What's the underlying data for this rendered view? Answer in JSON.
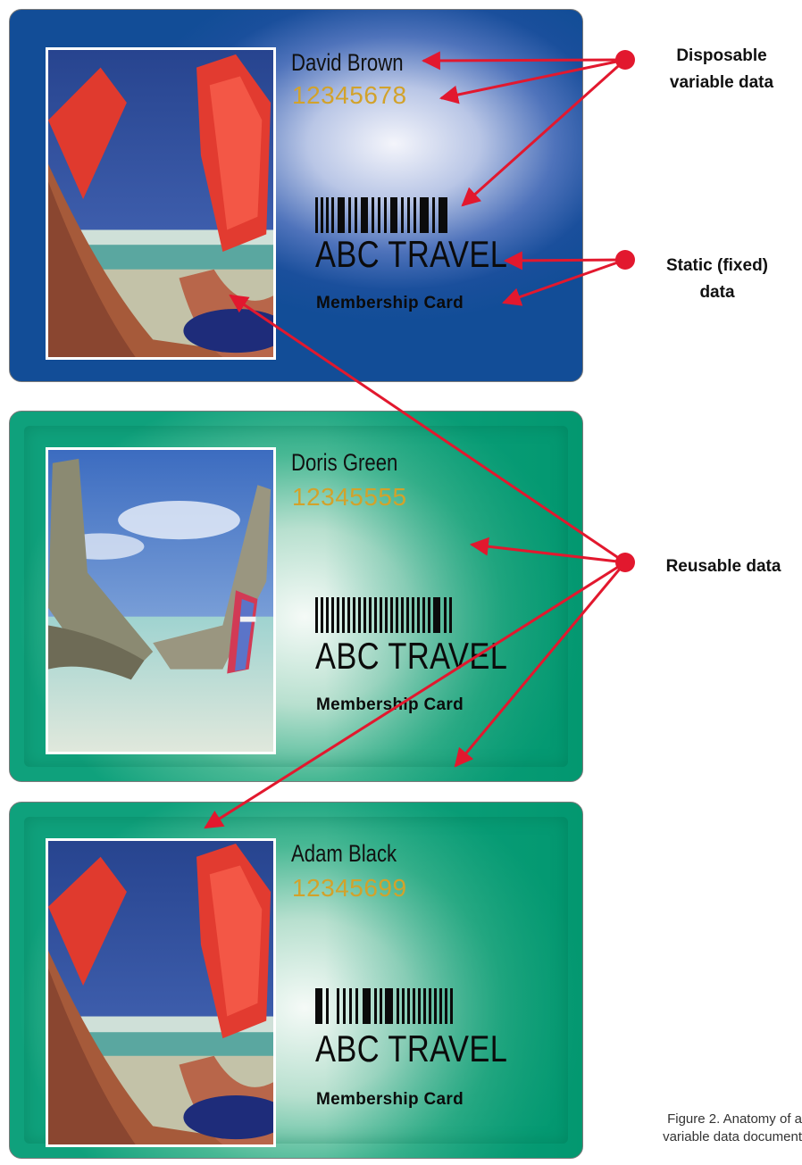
{
  "colors": {
    "arrow": "#e2182e",
    "number": "#d2a22b",
    "card_blue": "#124d97",
    "card_green": "#0fa17c"
  },
  "cards": [
    {
      "name": "David Brown",
      "number": "12345678",
      "brand": "ABC TRAVEL",
      "subtitle": "Membership Card",
      "photo": "snorkel-fins-beach"
    },
    {
      "name": "Doris Green",
      "number": "12345555",
      "brand": "ABC TRAVEL",
      "subtitle": "Membership Card",
      "photo": "longtail-boats-beach"
    },
    {
      "name": "Adam Black",
      "number": "12345699",
      "brand": "ABC TRAVEL",
      "subtitle": "Membership Card",
      "photo": "snorkel-fins-beach"
    }
  ],
  "labels": {
    "disposable": "Disposable\nvariable data",
    "static": "Static (fixed)\ndata",
    "reusable": "Reusable data"
  },
  "caption": {
    "line1": "Figure 2. Anatomy of a",
    "line2": "variable data document"
  }
}
